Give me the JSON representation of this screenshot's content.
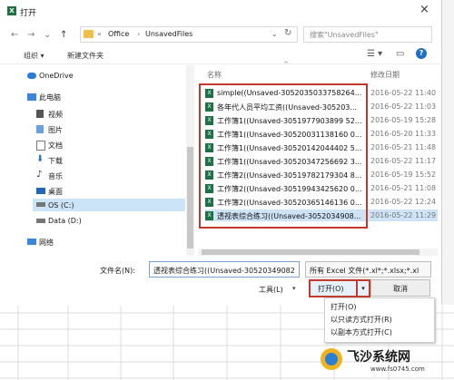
{
  "dialog": {
    "title": "打开",
    "app_icon": "X",
    "close": "×"
  },
  "address": {
    "back": "←",
    "forward": "→",
    "recent": "⌄",
    "up": "↑",
    "sep1": "«",
    "crumb1": "Office",
    "sep2": "›",
    "crumb2": "UnsavedFiles",
    "dropdown": "⌄",
    "refresh": "↻",
    "search_placeholder": "搜索\"UnsavedFiles\""
  },
  "toolbar": {
    "organize": "组织 ▾",
    "new_folder": "新建文件夹",
    "view_icon": "☰ ▾",
    "pane_icon": "▭",
    "help": "?"
  },
  "nav": {
    "items": [
      {
        "label": "OneDrive",
        "icon": "cloud-icon"
      },
      {
        "label": "此电脑",
        "icon": "computer-icon"
      },
      {
        "label": "视频",
        "icon": "video-icon"
      },
      {
        "label": "图片",
        "icon": "picture-icon"
      },
      {
        "label": "文档",
        "icon": "document-icon"
      },
      {
        "label": "下载",
        "icon": "download-icon"
      },
      {
        "label": "音乐",
        "icon": "music-icon"
      },
      {
        "label": "桌面",
        "icon": "desktop-icon"
      },
      {
        "label": "OS (C:)",
        "icon": "drive-icon"
      },
      {
        "label": "Data (D:)",
        "icon": "drive-icon"
      },
      {
        "label": "网络",
        "icon": "network-icon"
      }
    ]
  },
  "files": {
    "col_name": "名称",
    "col_date": "修改日期",
    "sort_caret": "^",
    "rows": [
      {
        "name": "simple((Unsaved-3052035033758264...",
        "date": "2016-05-22 11:40"
      },
      {
        "name": "各年代人员平均工资((Unsaved-305203...",
        "date": "2016-05-22 11:03"
      },
      {
        "name": "工作簿1((Unsaved-3051977903899 52...",
        "date": "2016-05-19 15:28"
      },
      {
        "name": "工作簿1((Unsaved-30520031138160 0...",
        "date": "2016-05-20 11:33"
      },
      {
        "name": "工作簿1((Unsaved-30520142044402 5...",
        "date": "2016-05-21 11:48"
      },
      {
        "name": "工作簿1((Unsaved-30520347256692 3...",
        "date": "2016-05-22 11:17"
      },
      {
        "name": "工作簿2((Unsaved-30519782179304 8...",
        "date": "2016-05-19 15:52"
      },
      {
        "name": "工作簿2((Unsaved-30519943425620 0...",
        "date": "2016-05-21 11:08"
      },
      {
        "name": "工作簿2((Unsaved-30520365146136 0...",
        "date": "2016-05-22 12:24"
      },
      {
        "name": "透视表综合练习((Unsaved-3052034908...",
        "date": "2016-05-22 11:29"
      }
    ]
  },
  "footer": {
    "filename_label": "文件名(N):",
    "filename_value": "透视表综合练习((Unsaved-30520349082",
    "filter_value": "所有 Excel 文件(*.xl*;*.xlsx;*.xl",
    "tools": "工具(L)",
    "tools_caret": "▾",
    "open": "打开(O)",
    "open_caret": "▾",
    "cancel": "取消"
  },
  "open_menu": {
    "items": [
      "打开(O)",
      "以只读方式打开(R)",
      "以副本方式打开(C)"
    ]
  },
  "watermark": {
    "title": "飞沙系统网",
    "url": "www.fs0745.com"
  },
  "colors": {
    "highlight": "#c0392b",
    "selected_row": "#cfe3f7",
    "excel_green": "#1e7145"
  }
}
